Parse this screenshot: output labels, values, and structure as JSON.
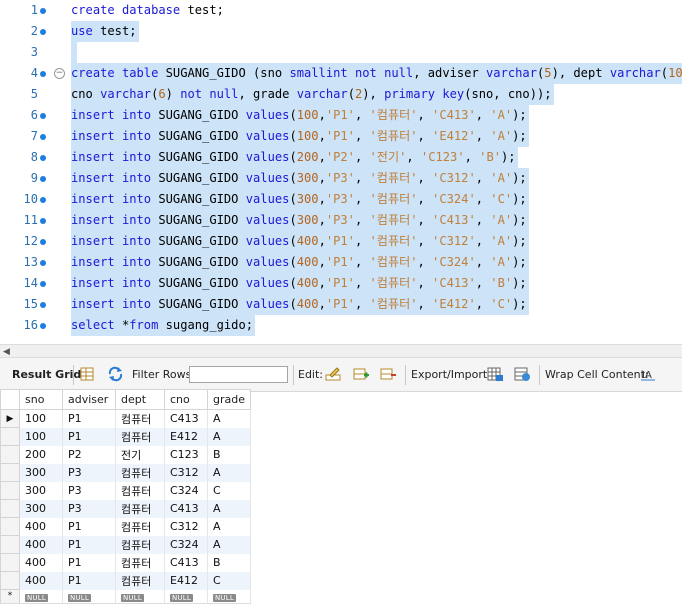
{
  "editor": {
    "lines": [
      {
        "n": "1",
        "bp": true,
        "fold": false,
        "sel": false,
        "tokens": [
          [
            "kw",
            "create database "
          ],
          [
            "t",
            "test;"
          ]
        ]
      },
      {
        "n": "2",
        "bp": true,
        "fold": false,
        "sel": true,
        "tokens": [
          [
            "kw",
            "use "
          ],
          [
            "t",
            "test;"
          ]
        ]
      },
      {
        "n": "3",
        "bp": false,
        "fold": false,
        "sel": true,
        "tokens": []
      },
      {
        "n": "4",
        "bp": true,
        "fold": true,
        "sel": true,
        "tokens": [
          [
            "kw",
            "create table "
          ],
          [
            "t",
            "SUGANG_GIDO (sno "
          ],
          [
            "kw",
            "smallint not null"
          ],
          [
            "t",
            ", adviser "
          ],
          [
            "kw",
            "varchar"
          ],
          [
            "t",
            "("
          ],
          [
            "num",
            "5"
          ],
          [
            "t",
            "), dept "
          ],
          [
            "kw",
            "varchar"
          ],
          [
            "t",
            "("
          ],
          [
            "num",
            "10"
          ],
          [
            "t",
            "),"
          ]
        ]
      },
      {
        "n": "5",
        "bp": false,
        "fold": false,
        "sel": true,
        "tokens": [
          [
            "t",
            "cno "
          ],
          [
            "kw",
            "varchar"
          ],
          [
            "t",
            "("
          ],
          [
            "num",
            "6"
          ],
          [
            "t",
            ") "
          ],
          [
            "kw",
            "not null"
          ],
          [
            "t",
            ", grade "
          ],
          [
            "kw",
            "varchar"
          ],
          [
            "t",
            "("
          ],
          [
            "num",
            "2"
          ],
          [
            "t",
            "), "
          ],
          [
            "kw",
            "primary key"
          ],
          [
            "t",
            "(sno, cno));"
          ]
        ]
      },
      {
        "n": "6",
        "bp": true,
        "fold": false,
        "sel": true,
        "tokens": [
          [
            "kw",
            "insert into "
          ],
          [
            "t",
            "SUGANG_GIDO "
          ],
          [
            "fn",
            "values"
          ],
          [
            "t",
            "("
          ],
          [
            "num",
            "100"
          ],
          [
            "t",
            ","
          ],
          [
            "str",
            "'P1'"
          ],
          [
            "t",
            ", "
          ],
          [
            "str",
            "'컴퓨터'"
          ],
          [
            "t",
            ", "
          ],
          [
            "str",
            "'C413'"
          ],
          [
            "t",
            ", "
          ],
          [
            "str",
            "'A'"
          ],
          [
            "t",
            ");"
          ]
        ]
      },
      {
        "n": "7",
        "bp": true,
        "fold": false,
        "sel": true,
        "tokens": [
          [
            "kw",
            "insert into "
          ],
          [
            "t",
            "SUGANG_GIDO "
          ],
          [
            "fn",
            "values"
          ],
          [
            "t",
            "("
          ],
          [
            "num",
            "100"
          ],
          [
            "t",
            ","
          ],
          [
            "str",
            "'P1'"
          ],
          [
            "t",
            ", "
          ],
          [
            "str",
            "'컴퓨터'"
          ],
          [
            "t",
            ", "
          ],
          [
            "str",
            "'E412'"
          ],
          [
            "t",
            ", "
          ],
          [
            "str",
            "'A'"
          ],
          [
            "t",
            ");"
          ]
        ]
      },
      {
        "n": "8",
        "bp": true,
        "fold": false,
        "sel": true,
        "tokens": [
          [
            "kw",
            "insert into "
          ],
          [
            "t",
            "SUGANG_GIDO "
          ],
          [
            "fn",
            "values"
          ],
          [
            "t",
            "("
          ],
          [
            "num",
            "200"
          ],
          [
            "t",
            ","
          ],
          [
            "str",
            "'P2'"
          ],
          [
            "t",
            ", "
          ],
          [
            "str",
            "'전기'"
          ],
          [
            "t",
            ", "
          ],
          [
            "str",
            "'C123'"
          ],
          [
            "t",
            ", "
          ],
          [
            "str",
            "'B'"
          ],
          [
            "t",
            ");"
          ]
        ]
      },
      {
        "n": "9",
        "bp": true,
        "fold": false,
        "sel": true,
        "tokens": [
          [
            "kw",
            "insert into "
          ],
          [
            "t",
            "SUGANG_GIDO "
          ],
          [
            "fn",
            "values"
          ],
          [
            "t",
            "("
          ],
          [
            "num",
            "300"
          ],
          [
            "t",
            ","
          ],
          [
            "str",
            "'P3'"
          ],
          [
            "t",
            ", "
          ],
          [
            "str",
            "'컴퓨터'"
          ],
          [
            "t",
            ", "
          ],
          [
            "str",
            "'C312'"
          ],
          [
            "t",
            ", "
          ],
          [
            "str",
            "'A'"
          ],
          [
            "t",
            ");"
          ]
        ]
      },
      {
        "n": "10",
        "bp": true,
        "fold": false,
        "sel": true,
        "tokens": [
          [
            "kw",
            "insert into "
          ],
          [
            "t",
            "SUGANG_GIDO "
          ],
          [
            "fn",
            "values"
          ],
          [
            "t",
            "("
          ],
          [
            "num",
            "300"
          ],
          [
            "t",
            ","
          ],
          [
            "str",
            "'P3'"
          ],
          [
            "t",
            ", "
          ],
          [
            "str",
            "'컴퓨터'"
          ],
          [
            "t",
            ", "
          ],
          [
            "str",
            "'C324'"
          ],
          [
            "t",
            ", "
          ],
          [
            "str",
            "'C'"
          ],
          [
            "t",
            ");"
          ]
        ]
      },
      {
        "n": "11",
        "bp": true,
        "fold": false,
        "sel": true,
        "tokens": [
          [
            "kw",
            "insert into "
          ],
          [
            "t",
            "SUGANG_GIDO "
          ],
          [
            "fn",
            "values"
          ],
          [
            "t",
            "("
          ],
          [
            "num",
            "300"
          ],
          [
            "t",
            ","
          ],
          [
            "str",
            "'P3'"
          ],
          [
            "t",
            ", "
          ],
          [
            "str",
            "'컴퓨터'"
          ],
          [
            "t",
            ", "
          ],
          [
            "str",
            "'C413'"
          ],
          [
            "t",
            ", "
          ],
          [
            "str",
            "'A'"
          ],
          [
            "t",
            ");"
          ]
        ]
      },
      {
        "n": "12",
        "bp": true,
        "fold": false,
        "sel": true,
        "tokens": [
          [
            "kw",
            "insert into "
          ],
          [
            "t",
            "SUGANG_GIDO "
          ],
          [
            "fn",
            "values"
          ],
          [
            "t",
            "("
          ],
          [
            "num",
            "400"
          ],
          [
            "t",
            ","
          ],
          [
            "str",
            "'P1'"
          ],
          [
            "t",
            ", "
          ],
          [
            "str",
            "'컴퓨터'"
          ],
          [
            "t",
            ", "
          ],
          [
            "str",
            "'C312'"
          ],
          [
            "t",
            ", "
          ],
          [
            "str",
            "'A'"
          ],
          [
            "t",
            ");"
          ]
        ]
      },
      {
        "n": "13",
        "bp": true,
        "fold": false,
        "sel": true,
        "tokens": [
          [
            "kw",
            "insert into "
          ],
          [
            "t",
            "SUGANG_GIDO "
          ],
          [
            "fn",
            "values"
          ],
          [
            "t",
            "("
          ],
          [
            "num",
            "400"
          ],
          [
            "t",
            ","
          ],
          [
            "str",
            "'P1'"
          ],
          [
            "t",
            ", "
          ],
          [
            "str",
            "'컴퓨터'"
          ],
          [
            "t",
            ", "
          ],
          [
            "str",
            "'C324'"
          ],
          [
            "t",
            ", "
          ],
          [
            "str",
            "'A'"
          ],
          [
            "t",
            ");"
          ]
        ]
      },
      {
        "n": "14",
        "bp": true,
        "fold": false,
        "sel": true,
        "tokens": [
          [
            "kw",
            "insert into "
          ],
          [
            "t",
            "SUGANG_GIDO "
          ],
          [
            "fn",
            "values"
          ],
          [
            "t",
            "("
          ],
          [
            "num",
            "400"
          ],
          [
            "t",
            ","
          ],
          [
            "str",
            "'P1'"
          ],
          [
            "t",
            ", "
          ],
          [
            "str",
            "'컴퓨터'"
          ],
          [
            "t",
            ", "
          ],
          [
            "str",
            "'C413'"
          ],
          [
            "t",
            ", "
          ],
          [
            "str",
            "'B'"
          ],
          [
            "t",
            ");"
          ]
        ]
      },
      {
        "n": "15",
        "bp": true,
        "fold": false,
        "sel": true,
        "tokens": [
          [
            "kw",
            "insert into "
          ],
          [
            "t",
            "SUGANG_GIDO "
          ],
          [
            "fn",
            "values"
          ],
          [
            "t",
            "("
          ],
          [
            "num",
            "400"
          ],
          [
            "t",
            ","
          ],
          [
            "str",
            "'P1'"
          ],
          [
            "t",
            ", "
          ],
          [
            "str",
            "'컴퓨터'"
          ],
          [
            "t",
            ", "
          ],
          [
            "str",
            "'E412'"
          ],
          [
            "t",
            ", "
          ],
          [
            "str",
            "'C'"
          ],
          [
            "t",
            ");"
          ]
        ]
      },
      {
        "n": "16",
        "bp": true,
        "fold": false,
        "sel": true,
        "tokens": [
          [
            "kw",
            "select "
          ],
          [
            "t",
            "*"
          ],
          [
            "kw",
            "from "
          ],
          [
            "t",
            "sugang_gido;"
          ]
        ]
      }
    ]
  },
  "toolbar": {
    "result_grid": "Result Grid",
    "filter_rows": "Filter Rows:",
    "filter_value": "",
    "edit": "Edit:",
    "export_import": "Export/Import:",
    "wrap_cell": "Wrap Cell Content:"
  },
  "grid": {
    "columns": [
      "sno",
      "adviser",
      "dept",
      "cno",
      "grade"
    ],
    "rows": [
      [
        "100",
        "P1",
        "컴퓨터",
        "C413",
        "A"
      ],
      [
        "100",
        "P1",
        "컴퓨터",
        "E412",
        "A"
      ],
      [
        "200",
        "P2",
        "전기",
        "C123",
        "B"
      ],
      [
        "300",
        "P3",
        "컴퓨터",
        "C312",
        "A"
      ],
      [
        "300",
        "P3",
        "컴퓨터",
        "C324",
        "C"
      ],
      [
        "300",
        "P3",
        "컴퓨터",
        "C413",
        "A"
      ],
      [
        "400",
        "P1",
        "컴퓨터",
        "C312",
        "A"
      ],
      [
        "400",
        "P1",
        "컴퓨터",
        "C324",
        "A"
      ],
      [
        "400",
        "P1",
        "컴퓨터",
        "C413",
        "B"
      ],
      [
        "400",
        "P1",
        "컴퓨터",
        "E412",
        "C"
      ]
    ],
    "null_label": "NULL",
    "current_row_marker": "▶",
    "new_row_marker": "*"
  },
  "colors": {
    "selection": "#cce3f8",
    "keyword": "#1a1ad6",
    "string": "#c0803a",
    "line_number": "#2c6fb0",
    "breakpoint": "#1e7de0"
  }
}
